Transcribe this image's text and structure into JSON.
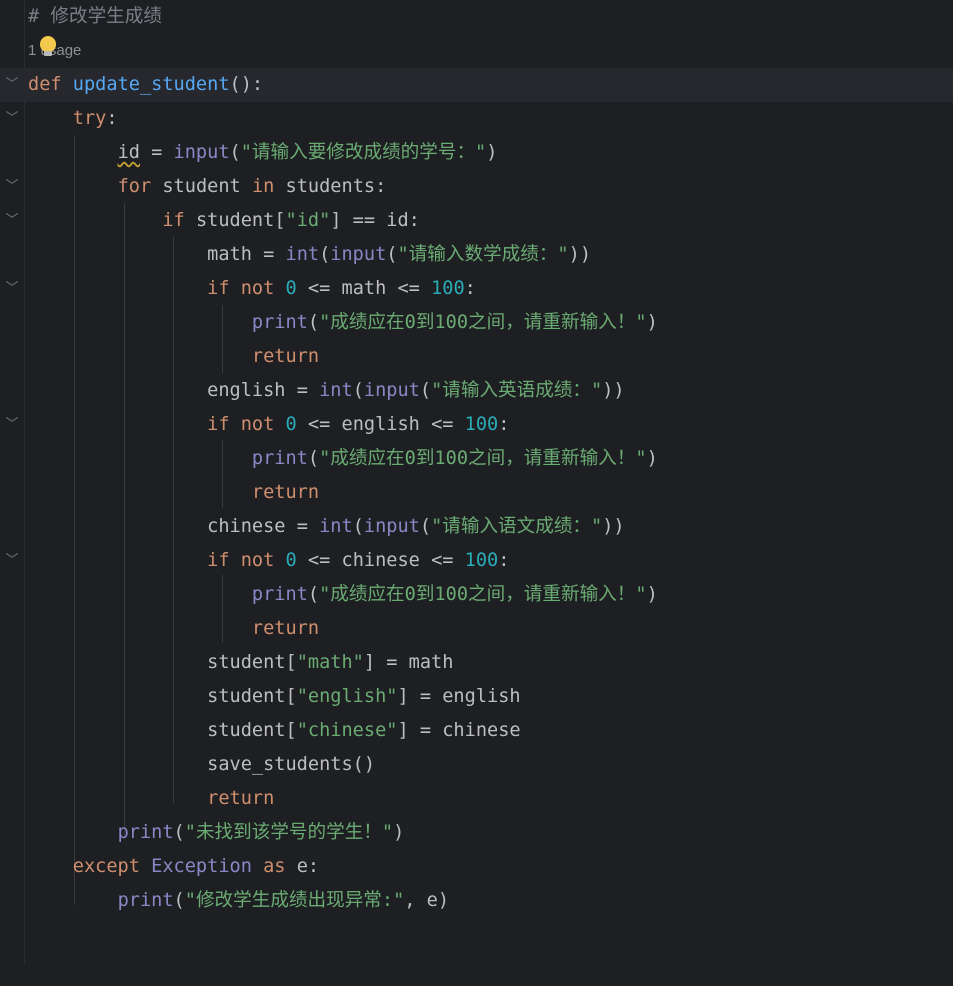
{
  "editor": {
    "comment": "# 修改学生成绩",
    "usage_hint": "1 usage",
    "strings": {
      "prompt_id": "\"请输入要修改成绩的学号：\"",
      "key_id": "\"id\"",
      "prompt_math": "\"请输入数学成绩：\"",
      "err_range": "\"成绩应在0到100之间，请重新输入！\"",
      "prompt_english": "\"请输入英语成绩：\"",
      "prompt_chinese": "\"请输入语文成绩：\"",
      "key_math": "\"math\"",
      "key_english": "\"english\"",
      "key_chinese": "\"chinese\"",
      "not_found": "\"未找到该学号的学生！\"",
      "exception_msg": "\"修改学生成绩出现异常:\""
    },
    "identifiers": {
      "func_name": "update_student",
      "var_id": "id",
      "var_student": "student",
      "var_students": "students",
      "var_math": "math",
      "var_english": "english",
      "var_chinese": "chinese",
      "save_func": "save_students",
      "exception_class": "Exception",
      "exc_var": "e"
    },
    "keywords": {
      "def": "def",
      "try": "try",
      "for": "for",
      "in": "in",
      "if": "if",
      "not": "not",
      "return": "return",
      "except": "except",
      "as": "as"
    },
    "builtins": {
      "input": "input",
      "int": "int",
      "print": "print"
    },
    "numbers": {
      "zero": "0",
      "hundred": "100"
    }
  },
  "colors": {
    "background": "#1e1f22",
    "current_line": "#26282e",
    "keyword": "#cf8e6d",
    "function": "#56a8f5",
    "builtin": "#8888c6",
    "string": "#6aab73",
    "number": "#2aacb8",
    "comment": "#7a7e85"
  }
}
